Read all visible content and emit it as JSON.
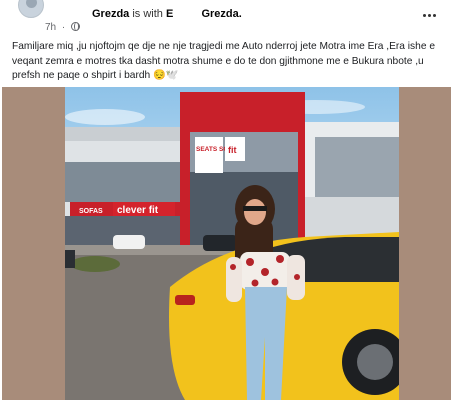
{
  "post": {
    "author_name": "Grezda",
    "with_text": "is with",
    "tagged_name": "E",
    "tagged_last": "Grezda.",
    "time": "7h",
    "separator": "·",
    "caption": "Familjare miq ,ju njoftojm qe dje ne nje tragjedi me Auto nderroj jete Motra ime Era ,Era ishe e veqant zemra e motres tka dasht motra shume e do te don gjithmone me e Bukura nbote ,u prefsh ne paqe o shpirt i bardh 😔🕊️",
    "photo": {
      "store_sign_1": "SEATS SOFAS",
      "store_sign_2": "fit",
      "store_sign_3": "SOFAS",
      "store_sign_4": "clever fit"
    }
  },
  "colors": {
    "background": "#ffffff",
    "text": "#050505",
    "secondary_text": "#65676b",
    "photo_frame": "#a88c7a",
    "car_yellow": "#f2c21c",
    "building_red": "#c8202a"
  },
  "icons": {
    "privacy": "globe-icon",
    "menu": "more-icon"
  }
}
